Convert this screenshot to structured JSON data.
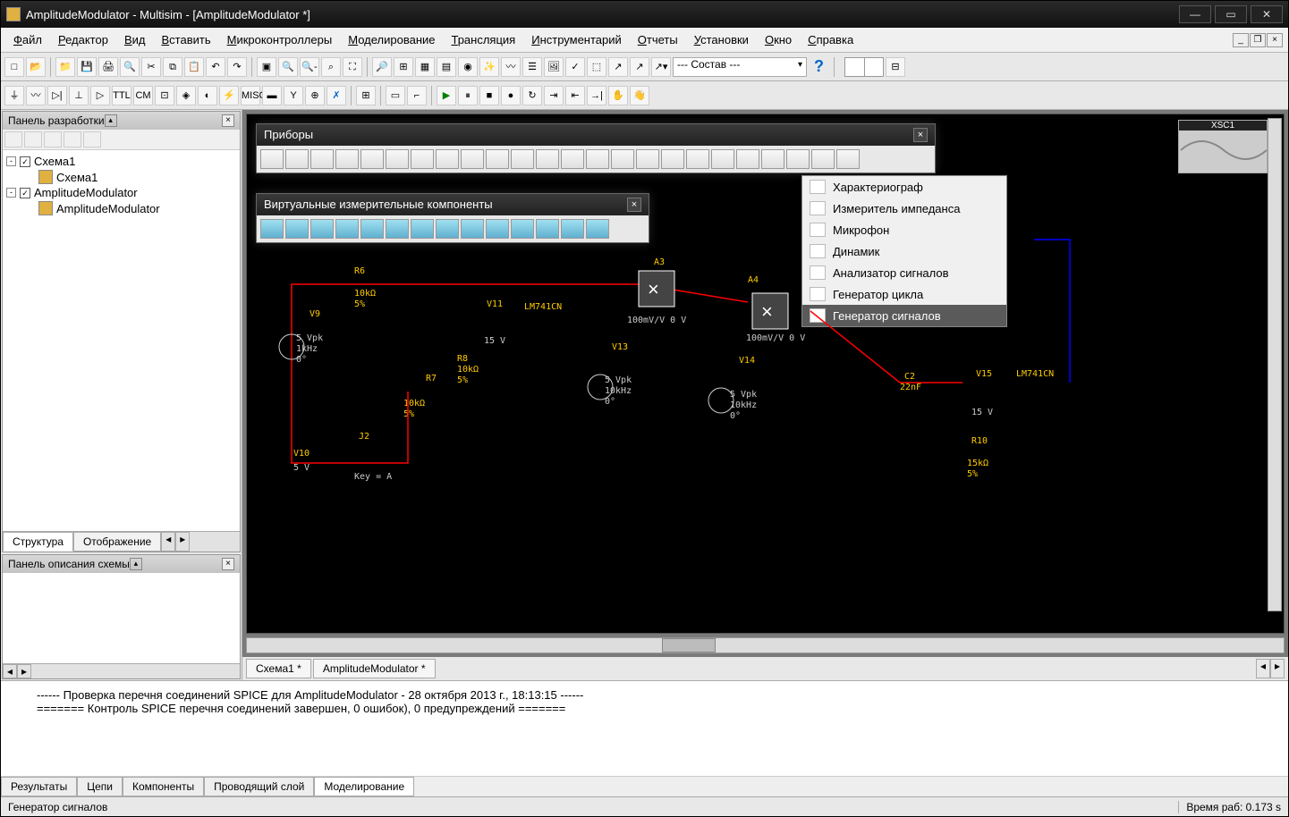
{
  "title": "AmplitudeModulator - Multisim - [AmplitudeModulator *]",
  "menu": [
    "Файл",
    "Редактор",
    "Вид",
    "Вставить",
    "Микроконтроллеры",
    "Моделирование",
    "Трансляция",
    "Инструментарий",
    "Отчеты",
    "Установки",
    "Окно",
    "Справка"
  ],
  "combo": "--- Состав ---",
  "left": {
    "panel1_title": "Панель разработки",
    "panel2_title": "Панель описания схемы",
    "tree": [
      {
        "lvl": 0,
        "tog": "-",
        "cb": "✓",
        "txt": "Схема1"
      },
      {
        "lvl": 1,
        "cb": "",
        "txt": "Схема1",
        "icon": true
      },
      {
        "lvl": 0,
        "tog": "-",
        "cb": "✓",
        "txt": "AmplitudeModulator"
      },
      {
        "lvl": 1,
        "cb": "",
        "txt": "AmplitudeModulator",
        "icon": true
      }
    ],
    "tabs": [
      "Структура",
      "Отображение"
    ]
  },
  "float1": {
    "title": "Приборы"
  },
  "float2": {
    "title": "Виртуальные измерительные компоненты"
  },
  "context": [
    "Характериограф",
    "Измеритель импеданса",
    "Микрофон",
    "Динамик",
    "Анализатор сигналов",
    "Генератор цикла",
    "Генератор сигналов"
  ],
  "context_sel": 6,
  "xsc": "XSC1",
  "schem": {
    "r6": "R6",
    "r6v": "10kΩ",
    "r6t": "5%",
    "v9": "V9",
    "v9a": "5 Vpk",
    "v9b": "1kHz",
    "v9c": "0°",
    "v11": "V11",
    "v11v": "15 V",
    "lm": "LM741CN",
    "r8": "R8",
    "r8v": "10kΩ",
    "r8t": "5%",
    "r7": "R7",
    "r7v": "10kΩ",
    "r7t": "5%",
    "j2": "J2",
    "v10": "V10",
    "v10v": "5 V",
    "key": "Key = A",
    "a3": "A3",
    "a3v": "100mV/V 0 V",
    "a4": "A4",
    "a4v": "100mV/V 0 V",
    "v13": "V13",
    "v13a": "5 Vpk",
    "v13b": "10kHz",
    "v13c": "0°",
    "v14": "V14",
    "v14a": "5 Vpk",
    "v14b": "10kHz",
    "v14c": "0°",
    "c2": "C2",
    "c2v": "22nF",
    "v15": "V15",
    "v15v": "15 V",
    "lm2": "LM741CN",
    "r10": "R10",
    "r10v": "15kΩ",
    "r10t": "5%"
  },
  "doctabs": [
    "Схема1 *",
    "AmplitudeModulator *"
  ],
  "out": [
    "------ Проверка перечня соединений SPICE для AmplitudeModulator - 28 октября 2013 г., 18:13:15 ------",
    "======= Контроль SPICE перечня соединений завершен, 0 ошибок), 0 предупреждений ======="
  ],
  "btabs": [
    "Результаты",
    "Цепи",
    "Компоненты",
    "Проводящий слой",
    "Моделирование"
  ],
  "btab_active": 4,
  "status_left": "Генератор сигналов",
  "status_right": "Время раб: 0.173 s"
}
